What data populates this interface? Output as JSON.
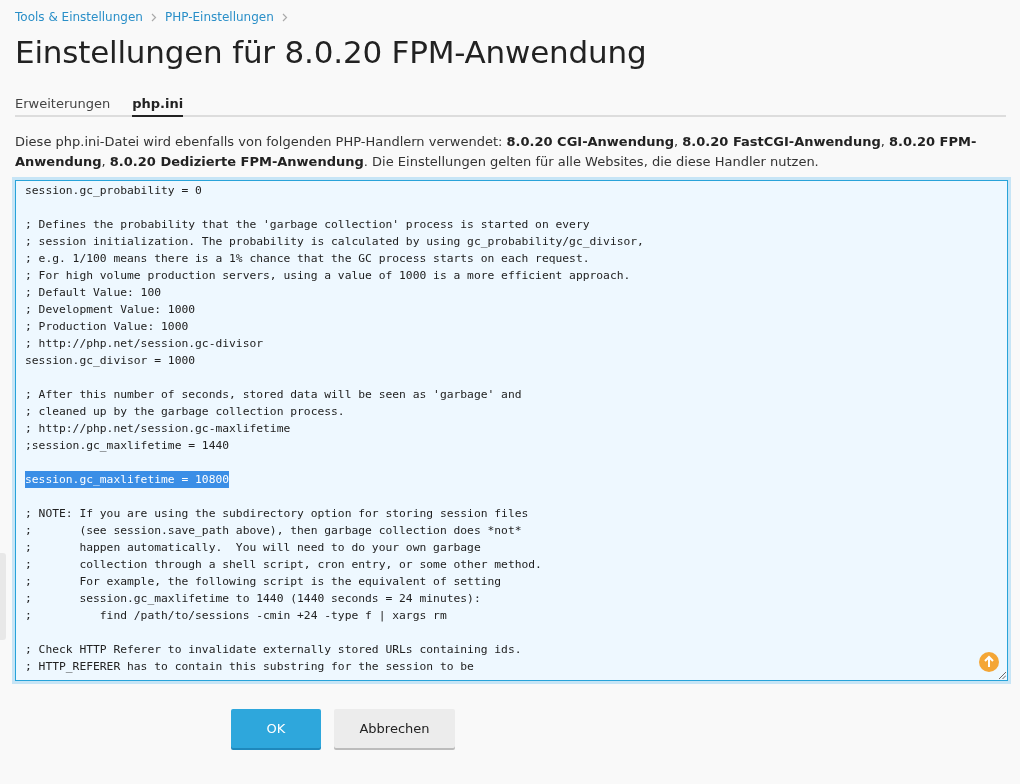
{
  "breadcrumbs": [
    "Tools & Einstellungen",
    "PHP-Einstellungen"
  ],
  "title": "Einstellungen für 8.0.20 FPM-Anwendung",
  "tabs": [
    {
      "label": "Erweiterungen",
      "selected": false
    },
    {
      "label": "php.ini",
      "selected": true
    }
  ],
  "description": "Diese php.ini-Datei wird ebenfalls von folgenden PHP-Handlern verwendet: **8.0.20 CGI-Anwendung**, **8.0.20 FastCGI-Anwendung**, **8.0.20 FPM-Anwendung**, **8.0.20 Dedizierte FPM-Anwendung**. Die Einstellungen gelten für alle Websites, die diese Handler nutzen.",
  "editor": {
    "lines": [
      {
        "kind": "text",
        "text": "session.gc_probability = 0",
        "selected": false
      },
      {
        "kind": "blank"
      },
      {
        "kind": "text",
        "text": "; Defines the probability that the 'garbage collection' process is started on every",
        "selected": false
      },
      {
        "kind": "text",
        "text": "; session initialization. The probability is calculated by using gc_probability/gc_divisor,",
        "selected": false
      },
      {
        "kind": "text",
        "text": "; e.g. 1/100 means there is a 1% chance that the GC process starts on each request.",
        "selected": false
      },
      {
        "kind": "text",
        "text": "; For high volume production servers, using a value of 1000 is a more efficient approach.",
        "selected": false
      },
      {
        "kind": "text",
        "text": "; Default Value: 100",
        "selected": false
      },
      {
        "kind": "text",
        "text": "; Development Value: 1000",
        "selected": false
      },
      {
        "kind": "text",
        "text": "; Production Value: 1000",
        "selected": false
      },
      {
        "kind": "text",
        "text": "; http://php.net/session.gc-divisor",
        "selected": false
      },
      {
        "kind": "text",
        "text": "session.gc_divisor = 1000",
        "selected": false
      },
      {
        "kind": "blank"
      },
      {
        "kind": "text",
        "text": "; After this number of seconds, stored data will be seen as 'garbage' and",
        "selected": false
      },
      {
        "kind": "text",
        "text": "; cleaned up by the garbage collection process.",
        "selected": false
      },
      {
        "kind": "text",
        "text": "; http://php.net/session.gc-maxlifetime",
        "selected": false
      },
      {
        "kind": "text",
        "text": ";session.gc_maxlifetime = 1440",
        "selected": false
      },
      {
        "kind": "blank"
      },
      {
        "kind": "text",
        "text": "session.gc_maxlifetime = 10800",
        "selected": true
      },
      {
        "kind": "blank"
      },
      {
        "kind": "text",
        "text": "; NOTE: If you are using the subdirectory option for storing session files",
        "selected": false
      },
      {
        "kind": "text",
        "text": ";       (see session.save_path above), then garbage collection does *not*",
        "selected": false
      },
      {
        "kind": "text",
        "text": ";       happen automatically.  You will need to do your own garbage",
        "selected": false
      },
      {
        "kind": "text",
        "text": ";       collection through a shell script, cron entry, or some other method.",
        "selected": false
      },
      {
        "kind": "text",
        "text": ";       For example, the following script is the equivalent of setting",
        "selected": false
      },
      {
        "kind": "text",
        "text": ";       session.gc_maxlifetime to 1440 (1440 seconds = 24 minutes):",
        "selected": false
      },
      {
        "kind": "text",
        "text": ";          find /path/to/sessions -cmin +24 -type f | xargs rm",
        "selected": false
      },
      {
        "kind": "blank"
      },
      {
        "kind": "text",
        "text": "; Check HTTP Referer to invalidate externally stored URLs containing ids.",
        "selected": false
      },
      {
        "kind": "text",
        "text": "; HTTP_REFERER has to contain this substring for the session to be",
        "selected": false
      }
    ]
  },
  "buttons": [
    {
      "label": "OK",
      "kind": "primary"
    },
    {
      "label": "Abbrechen",
      "kind": "secondary"
    }
  ]
}
